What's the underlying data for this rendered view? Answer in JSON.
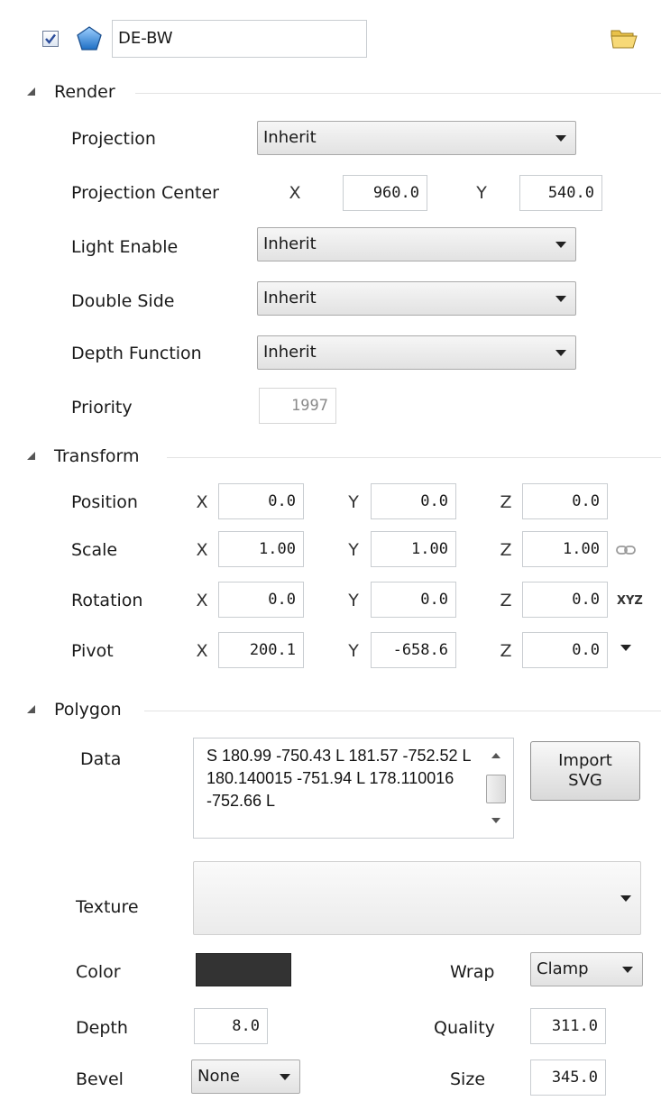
{
  "header": {
    "layer_name": "DE-BW",
    "folder_icon": "folder-open-icon",
    "shape_icon": "pentagon-icon",
    "checked": true
  },
  "render": {
    "title": "Render",
    "projection_label": "Projection",
    "projection_value": "Inherit",
    "projection_center_label": "Projection Center",
    "center_x_axis": "X",
    "center_x": "960.0",
    "center_y_axis": "Y",
    "center_y": "540.0",
    "light_enable_label": "Light Enable",
    "light_enable_value": "Inherit",
    "double_side_label": "Double Side",
    "double_side_value": "Inherit",
    "depth_function_label": "Depth Function",
    "depth_function_value": "Inherit",
    "priority_label": "Priority",
    "priority_value": "1997"
  },
  "transform": {
    "title": "Transform",
    "axis_x": "X",
    "axis_y": "Y",
    "axis_z": "Z",
    "position": {
      "label": "Position",
      "x": "0.0",
      "y": "0.0",
      "z": "0.0"
    },
    "scale": {
      "label": "Scale",
      "x": "1.00",
      "y": "1.00",
      "z": "1.00"
    },
    "rotation": {
      "label": "Rotation",
      "x": "0.0",
      "y": "0.0",
      "z": "0.0",
      "order": "XYZ"
    },
    "pivot": {
      "label": "Pivot",
      "x": "200.1",
      "y": "-658.6",
      "z": "0.0"
    }
  },
  "polygon": {
    "title": "Polygon",
    "data_label": "Data",
    "data_value": "S 180.99 -750.43 L 181.57 -752.52 L 180.140015 -751.94 L 178.110016 -752.66 L",
    "import_line1": "Import",
    "import_line2": "SVG",
    "texture_label": "Texture",
    "texture_value": "",
    "color_label": "Color",
    "color_value": "#333333",
    "wrap_label": "Wrap",
    "wrap_value": "Clamp",
    "depth_label": "Depth",
    "depth_value": "8.0",
    "quality_label": "Quality",
    "quality_value": "311.0",
    "bevel_label": "Bevel",
    "bevel_value": "None",
    "size_label": "Size",
    "size_value": "345.0"
  }
}
